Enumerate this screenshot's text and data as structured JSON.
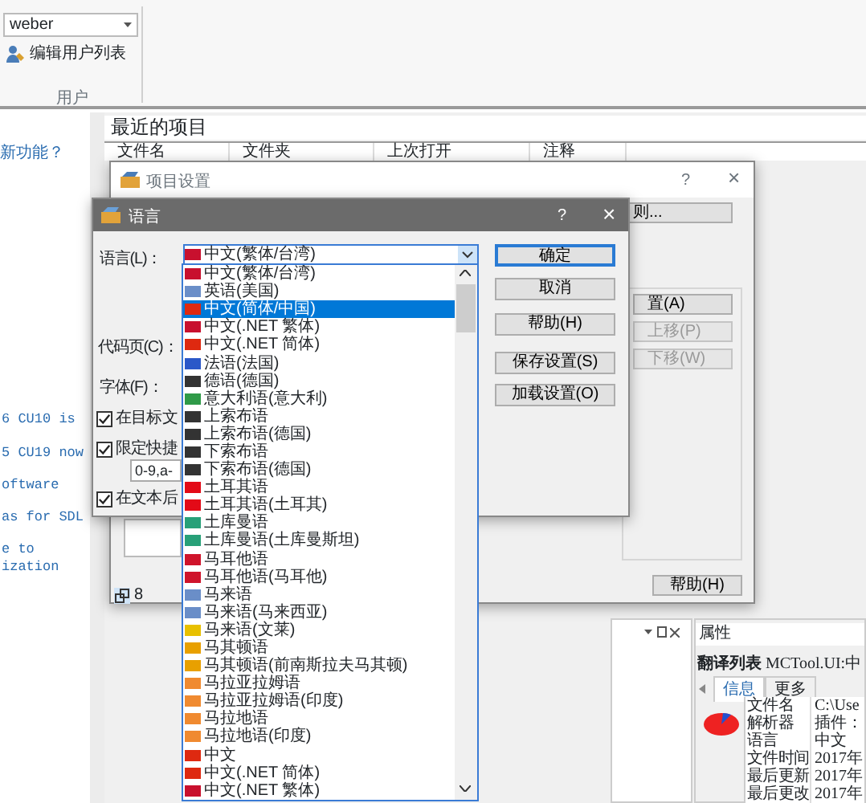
{
  "ribbon": {
    "user_select": "weber",
    "edit_users": "编辑用户列表",
    "group_label": "用户"
  },
  "sidebar": {
    "link": "新功能？",
    "news": [
      "6 CU10 is",
      "5 CU19 now",
      "oftware",
      "as for SDL",
      "e to",
      "ization"
    ]
  },
  "recent": {
    "title": "最近的项目",
    "columns": [
      "文件名",
      "文件夹",
      "上次打开",
      "注释"
    ]
  },
  "project_settings": {
    "title": "项目设置",
    "help_mark": "?",
    "close": "×",
    "rules_button": "则...",
    "buttons": [
      {
        "label": "置(A)",
        "disabled": false
      },
      {
        "label": "上移(P)",
        "disabled": true
      },
      {
        "label": "下移(W)",
        "disabled": true
      }
    ],
    "help_button": "帮助(H)",
    "count": "8"
  },
  "language_dialog": {
    "title": "语言",
    "help_mark": "?",
    "close": "×",
    "language_label": "语言(L)：",
    "language_value": "中文(繁体/台湾)",
    "codepage_label": "代码页(C)：",
    "font_label": "字体(F)：",
    "checkboxes": [
      {
        "label": "在目标文",
        "checked": true
      },
      {
        "label": "限定快捷",
        "checked": true
      },
      {
        "label": "在文本后",
        "checked": true
      }
    ],
    "shortcut_field": "0-9,a-",
    "buttons": [
      {
        "label": "确定",
        "default": true
      },
      {
        "label": "取消",
        "default": false
      },
      {
        "label": "帮助(H)",
        "default": false
      },
      {
        "label": "保存设置(S)",
        "default": false
      },
      {
        "label": "加载设置(O)",
        "default": false
      }
    ],
    "options": [
      {
        "label": "中文(繁体/台湾)",
        "color": "#c8102e",
        "selected": false
      },
      {
        "label": "英语(美国)",
        "color": "#6a8ec8",
        "selected": false
      },
      {
        "label": "中文(简体/中国)",
        "color": "#de2910",
        "selected": true
      },
      {
        "label": "中文(.NET 繁体)",
        "color": "#c8102e",
        "selected": false
      },
      {
        "label": "中文(.NET 简体)",
        "color": "#de2910",
        "selected": false
      },
      {
        "label": "法语(法国)",
        "color": "#2b58c8",
        "selected": false
      },
      {
        "label": "德语(德国)",
        "color": "#333333",
        "selected": false
      },
      {
        "label": "意大利语(意大利)",
        "color": "#2f9a48",
        "selected": false
      },
      {
        "label": "上索布语",
        "color": "#333333",
        "selected": false
      },
      {
        "label": "上索布语(德国)",
        "color": "#333333",
        "selected": false
      },
      {
        "label": "下索布语",
        "color": "#333333",
        "selected": false
      },
      {
        "label": "下索布语(德国)",
        "color": "#333333",
        "selected": false
      },
      {
        "label": "土耳其语",
        "color": "#e30a17",
        "selected": false
      },
      {
        "label": "土耳其语(土耳其)",
        "color": "#e30a17",
        "selected": false
      },
      {
        "label": "土库曼语",
        "color": "#28a078",
        "selected": false
      },
      {
        "label": "土库曼语(土库曼斯坦)",
        "color": "#28a078",
        "selected": false
      },
      {
        "label": "马耳他语",
        "color": "#cf142b",
        "selected": false
      },
      {
        "label": "马耳他语(马耳他)",
        "color": "#cf142b",
        "selected": false
      },
      {
        "label": "马来语",
        "color": "#6a8ec8",
        "selected": false
      },
      {
        "label": "马来语(马来西亚)",
        "color": "#6a8ec8",
        "selected": false
      },
      {
        "label": "马来语(文莱)",
        "color": "#e8c000",
        "selected": false
      },
      {
        "label": "马其顿语",
        "color": "#e8a000",
        "selected": false
      },
      {
        "label": "马其顿语(前南斯拉夫马其顿)",
        "color": "#e8a000",
        "selected": false
      },
      {
        "label": "马拉亚拉姆语",
        "color": "#f08a30",
        "selected": false
      },
      {
        "label": "马拉亚拉姆语(印度)",
        "color": "#f08a30",
        "selected": false
      },
      {
        "label": "马拉地语",
        "color": "#f08a30",
        "selected": false
      },
      {
        "label": "马拉地语(印度)",
        "color": "#f08a30",
        "selected": false
      },
      {
        "label": "中文",
        "color": "#de2910",
        "selected": false
      },
      {
        "label": "中文(.NET 简体)",
        "color": "#de2910",
        "selected": false
      },
      {
        "label": "中文(.NET 繁体)",
        "color": "#c8102e",
        "selected": false
      }
    ]
  },
  "properties": {
    "title": "属性",
    "heading": "翻译列表",
    "subject": "MCTool.UI:中",
    "tabs": [
      {
        "label": "信息",
        "selected": true
      },
      {
        "label": "更多",
        "selected": false
      }
    ],
    "rows": [
      {
        "name": "文件名",
        "value": "C:\\Use"
      },
      {
        "name": "解析器",
        "value": "插件："
      },
      {
        "name": "语言",
        "value": "中文"
      },
      {
        "name": "文件时间",
        "value": "2017年"
      },
      {
        "name": "最后更新",
        "value": "2017年"
      },
      {
        "name": "最后更改",
        "value": "2017年"
      }
    ]
  }
}
